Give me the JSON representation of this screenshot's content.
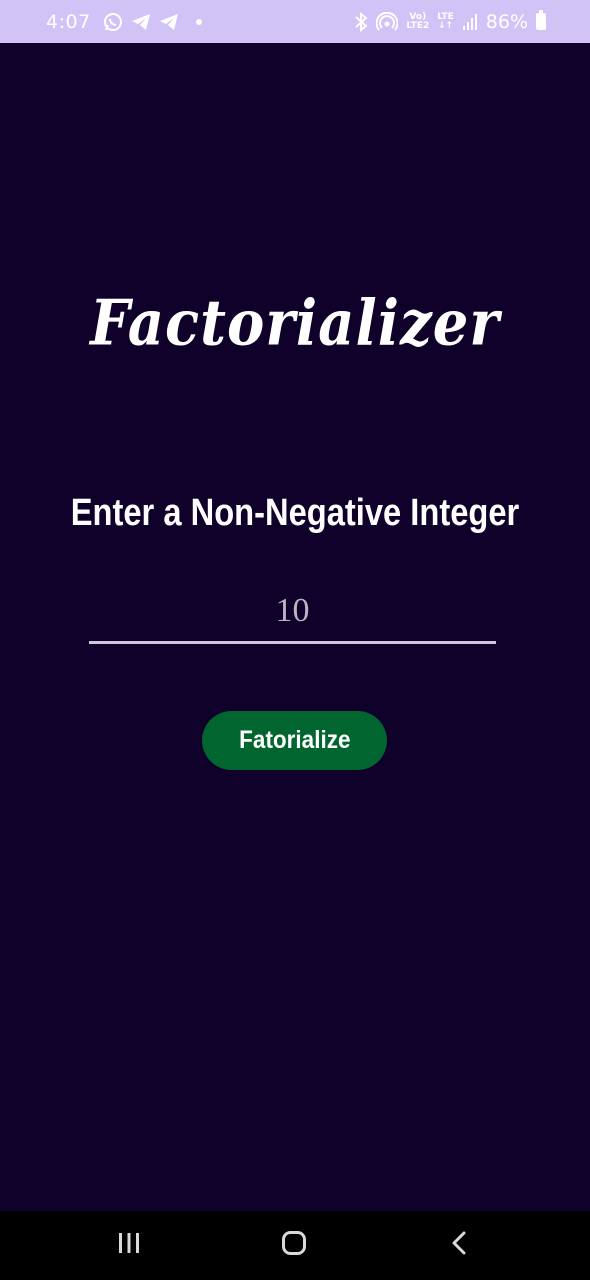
{
  "status_bar": {
    "time": "4:07",
    "network_top": "Vo)",
    "network_bottom": "LTE2",
    "lte_top": "LTE",
    "battery_percent": "86%",
    "icons": [
      "whatsapp-icon",
      "telegram-icon",
      "telegram-icon",
      "notification-dot-icon",
      "bluetooth-icon",
      "hotspot-icon",
      "volte-icon",
      "lte-data-icon",
      "signal-icon",
      "battery-charging-icon"
    ]
  },
  "app": {
    "title": "Factorializer",
    "prompt": "Enter a Non-Negative Integer",
    "input_value": "10",
    "button_label": "Fatorialize"
  },
  "nav_bar": {
    "icons": [
      "recents-icon",
      "home-icon",
      "back-icon"
    ]
  },
  "colors": {
    "background": "#10012a",
    "status_bar": "#d2c3f7",
    "button": "#00652e",
    "input_underline": "#cfc6de",
    "nav_bar": "#000000"
  }
}
